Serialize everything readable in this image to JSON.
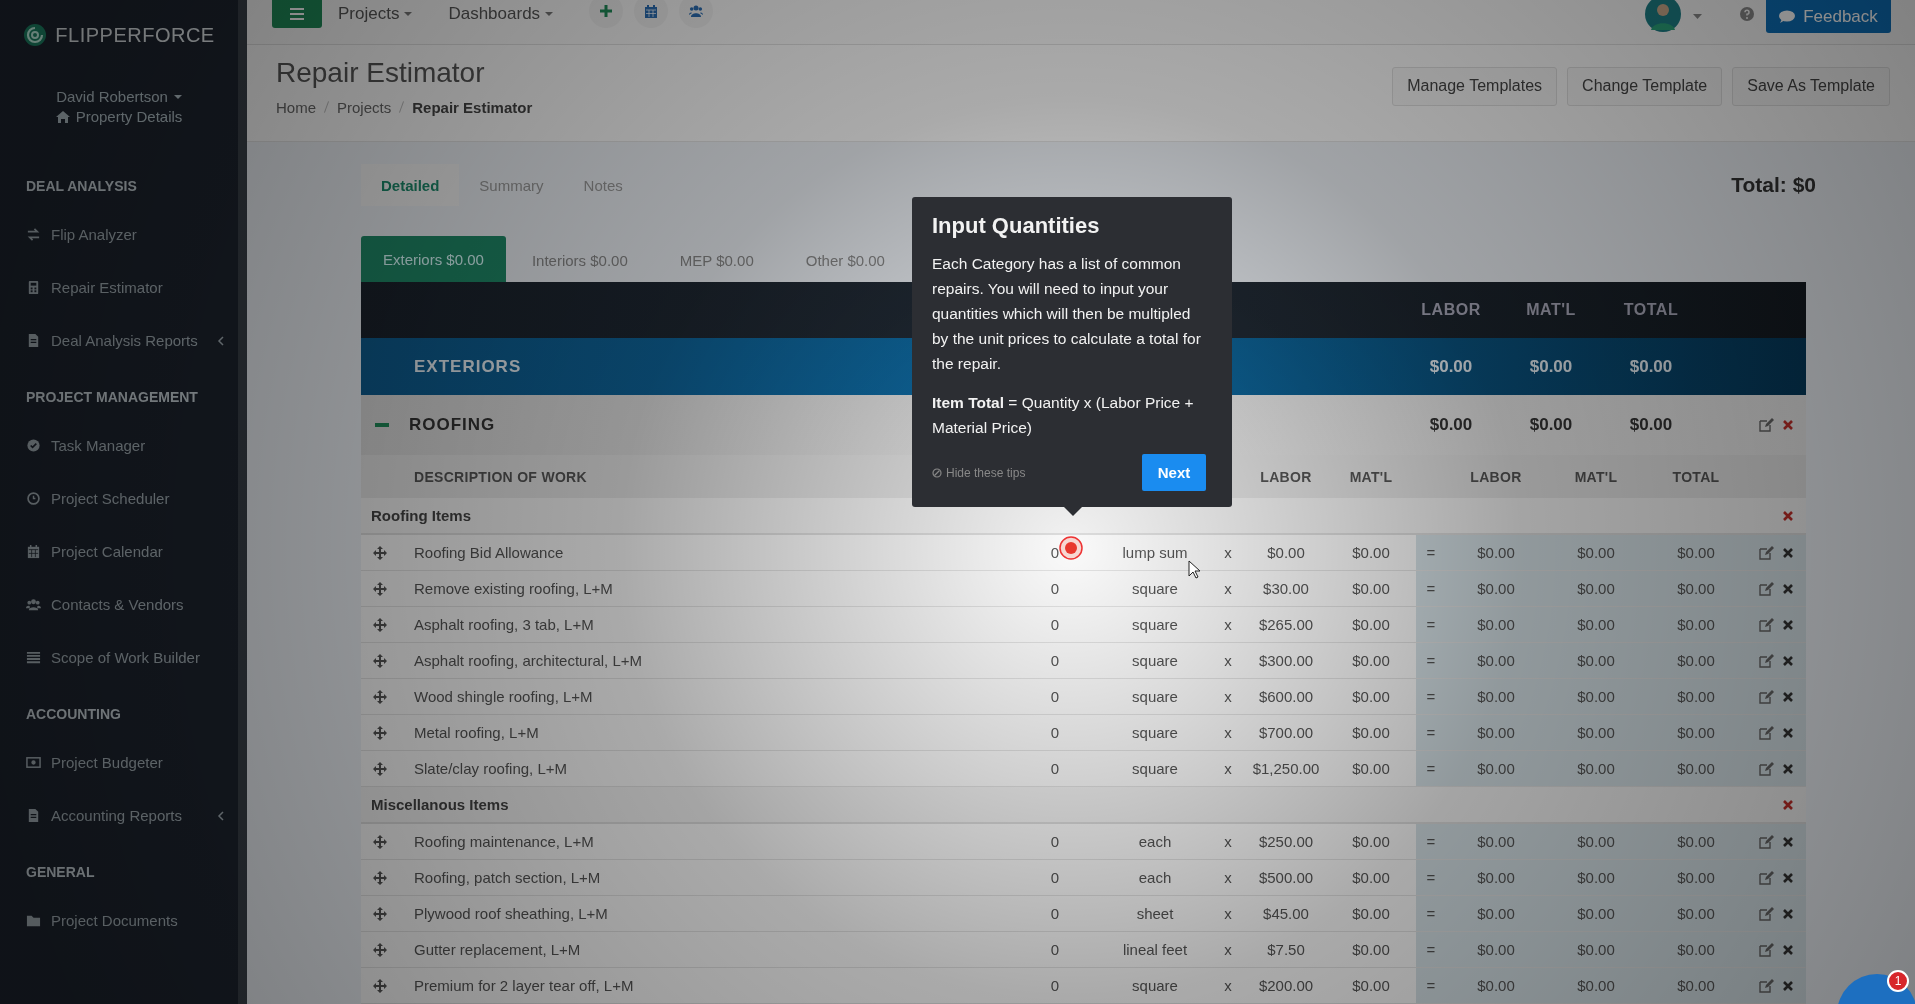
{
  "sidebar": {
    "logo": "FLIPPERFORCE",
    "user": "David Robertson",
    "property_link": "Property Details",
    "sections": [
      {
        "title": "DEAL ANALYSIS",
        "items": [
          {
            "label": "Flip Analyzer",
            "submenu": false
          },
          {
            "label": "Repair Estimator",
            "submenu": false
          },
          {
            "label": "Deal Analysis Reports",
            "submenu": true
          }
        ]
      },
      {
        "title": "PROJECT MANAGEMENT",
        "items": [
          {
            "label": "Task Manager",
            "submenu": false
          },
          {
            "label": "Project Scheduler",
            "submenu": false
          },
          {
            "label": "Project Calendar",
            "submenu": false
          },
          {
            "label": "Contacts & Vendors",
            "submenu": false
          },
          {
            "label": "Scope of Work Builder",
            "submenu": false
          }
        ]
      },
      {
        "title": "ACCOUNTING",
        "items": [
          {
            "label": "Project Budgeter",
            "submenu": false
          },
          {
            "label": "Accounting Reports",
            "submenu": true
          }
        ]
      },
      {
        "title": "GENERAL",
        "items": [
          {
            "label": "Project Documents",
            "submenu": false
          }
        ]
      }
    ]
  },
  "topbar": {
    "menus": [
      "Projects",
      "Dashboards"
    ],
    "feedback": "Feedback"
  },
  "header": {
    "title": "Repair Estimator",
    "breadcrumbs": [
      {
        "label": "Home",
        "current": false
      },
      {
        "label": "Projects",
        "current": false
      },
      {
        "label": "Repair Estimator",
        "current": true
      }
    ],
    "buttons": [
      "Manage Templates",
      "Change Template",
      "Save As Template"
    ]
  },
  "view_tabs": [
    {
      "label": "Detailed",
      "selected": true
    },
    {
      "label": "Summary",
      "selected": false
    },
    {
      "label": "Notes",
      "selected": false
    }
  ],
  "total": "Total: $0",
  "category_tabs": [
    {
      "label": "Exteriors $0.00",
      "selected": true
    },
    {
      "label": "Interiors $0.00",
      "selected": false
    },
    {
      "label": "MEP $0.00",
      "selected": false
    },
    {
      "label": "Other $0.00",
      "selected": false
    }
  ],
  "table": {
    "header_columns": [
      "LABOR",
      "MAT'L",
      "TOTAL"
    ],
    "section": {
      "name": "EXTERIORS",
      "labor": "$0.00",
      "matl": "$0.00",
      "total": "$0.00"
    },
    "category": {
      "name": "ROOFING",
      "expanded": true,
      "labor": "$0.00",
      "matl": "$0.00",
      "total": "$0.00"
    },
    "columns": {
      "description": "DESCRIPTION OF WORK",
      "unit_labor": "LABOR",
      "unit_matl": "MAT'L",
      "labor": "LABOR",
      "matl": "MAT'L",
      "total": "TOTAL"
    },
    "groups": [
      {
        "name": "Roofing Items",
        "items": [
          {
            "description": "Roofing Bid Allowance",
            "qty": "0",
            "unit": "lump sum",
            "times": "x",
            "unit_labor": "$0.00",
            "unit_matl": "$0.00",
            "equals": "=",
            "labor": "$0.00",
            "matl": "$0.00",
            "total": "$0.00"
          },
          {
            "description": "Remove existing roofing, L+M",
            "qty": "0",
            "unit": "square",
            "times": "x",
            "unit_labor": "$30.00",
            "unit_matl": "$0.00",
            "equals": "=",
            "labor": "$0.00",
            "matl": "$0.00",
            "total": "$0.00"
          },
          {
            "description": "Asphalt roofing, 3 tab, L+M",
            "qty": "0",
            "unit": "square",
            "times": "x",
            "unit_labor": "$265.00",
            "unit_matl": "$0.00",
            "equals": "=",
            "labor": "$0.00",
            "matl": "$0.00",
            "total": "$0.00"
          },
          {
            "description": "Asphalt roofing, architectural, L+M",
            "qty": "0",
            "unit": "square",
            "times": "x",
            "unit_labor": "$300.00",
            "unit_matl": "$0.00",
            "equals": "=",
            "labor": "$0.00",
            "matl": "$0.00",
            "total": "$0.00"
          },
          {
            "description": "Wood shingle roofing, L+M",
            "qty": "0",
            "unit": "square",
            "times": "x",
            "unit_labor": "$600.00",
            "unit_matl": "$0.00",
            "equals": "=",
            "labor": "$0.00",
            "matl": "$0.00",
            "total": "$0.00"
          },
          {
            "description": "Metal roofing, L+M",
            "qty": "0",
            "unit": "square",
            "times": "x",
            "unit_labor": "$700.00",
            "unit_matl": "$0.00",
            "equals": "=",
            "labor": "$0.00",
            "matl": "$0.00",
            "total": "$0.00"
          },
          {
            "description": "Slate/clay roofing, L+M",
            "qty": "0",
            "unit": "square",
            "times": "x",
            "unit_labor": "$1,250.00",
            "unit_matl": "$0.00",
            "equals": "=",
            "labor": "$0.00",
            "matl": "$0.00",
            "total": "$0.00"
          }
        ]
      },
      {
        "name": "Miscellanous Items",
        "items": [
          {
            "description": "Roofing maintenance, L+M",
            "qty": "0",
            "unit": "each",
            "times": "x",
            "unit_labor": "$250.00",
            "unit_matl": "$0.00",
            "equals": "=",
            "labor": "$0.00",
            "matl": "$0.00",
            "total": "$0.00"
          },
          {
            "description": "Roofing, patch section, L+M",
            "qty": "0",
            "unit": "each",
            "times": "x",
            "unit_labor": "$500.00",
            "unit_matl": "$0.00",
            "equals": "=",
            "labor": "$0.00",
            "matl": "$0.00",
            "total": "$0.00"
          },
          {
            "description": "Plywood roof sheathing, L+M",
            "qty": "0",
            "unit": "sheet",
            "times": "x",
            "unit_labor": "$45.00",
            "unit_matl": "$0.00",
            "equals": "=",
            "labor": "$0.00",
            "matl": "$0.00",
            "total": "$0.00"
          },
          {
            "description": "Gutter replacement, L+M",
            "qty": "0",
            "unit": "lineal feet",
            "times": "x",
            "unit_labor": "$7.50",
            "unit_matl": "$0.00",
            "equals": "=",
            "labor": "$0.00",
            "matl": "$0.00",
            "total": "$0.00"
          },
          {
            "description": "Premium for 2 layer tear off, L+M",
            "qty": "0",
            "unit": "square",
            "times": "x",
            "unit_labor": "$200.00",
            "unit_matl": "$0.00",
            "equals": "=",
            "labor": "$0.00",
            "matl": "$0.00",
            "total": "$0.00"
          }
        ]
      }
    ]
  },
  "tooltip": {
    "title": "Input Quantities",
    "paragraphs": [
      "Each Category has a list of common repairs.  You will need to input your quantities which will then be multipled by the unit prices to calculate a total for the repair.",
      "**Item Total** = Quantity x (Labor Price + Material Price)"
    ],
    "hide": "Hide these tips",
    "next": "Next"
  },
  "chat": {
    "badge": "1"
  }
}
